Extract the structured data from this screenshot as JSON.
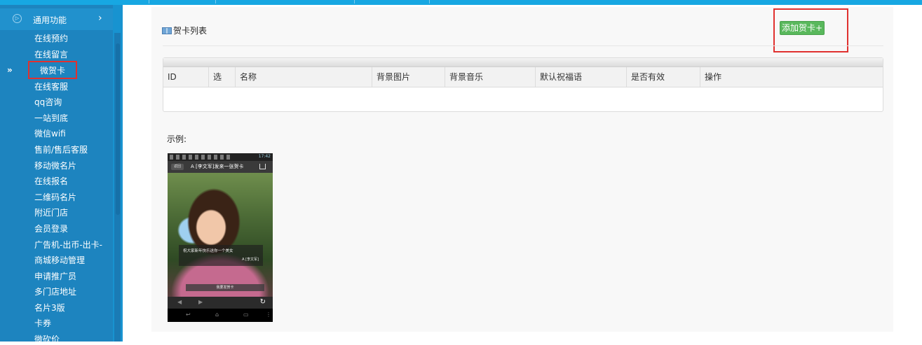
{
  "sidebar": {
    "group_label": "通用功能",
    "group_arrow": "›",
    "expander": "»",
    "items": [
      {
        "label": "在线预约"
      },
      {
        "label": "在线留言"
      },
      {
        "label": "微贺卡"
      },
      {
        "label": "在线客服"
      },
      {
        "label": "qq咨询"
      },
      {
        "label": "一站到底"
      },
      {
        "label": "微信wifi"
      },
      {
        "label": "售前/售后客服"
      },
      {
        "label": "移动微名片"
      },
      {
        "label": "在线报名"
      },
      {
        "label": "二维码名片"
      },
      {
        "label": "附近门店"
      },
      {
        "label": "会员登录"
      },
      {
        "label": "广告机-出币-出卡-"
      },
      {
        "label": "商城移动管理"
      },
      {
        "label": "申请推广员"
      },
      {
        "label": "多门店地址"
      },
      {
        "label": "名片3版"
      },
      {
        "label": "卡券"
      },
      {
        "label": "微砍价"
      }
    ],
    "active_item": "微贺卡"
  },
  "main": {
    "title": "贺卡列表",
    "add_button": "添加贺卡+",
    "table": {
      "columns": [
        "ID",
        "选",
        "名称",
        "背景图片",
        "背景音乐",
        "默认祝福语",
        "是否有效",
        "操作"
      ],
      "rows": []
    },
    "example_label": "示例:"
  },
  "phone": {
    "time": "17:42",
    "back": "返回",
    "title": "A [李文军]发来一张贺卡",
    "message": "祝大家新年快乐送你一个美女",
    "sender": "A [李文军]",
    "make_button": "我要发贺卡"
  },
  "colors": {
    "topbar": "#17a7e2",
    "sidebar": "#1d84bf",
    "add_button": "#59b85c",
    "highlight_box": "#e0312f"
  }
}
